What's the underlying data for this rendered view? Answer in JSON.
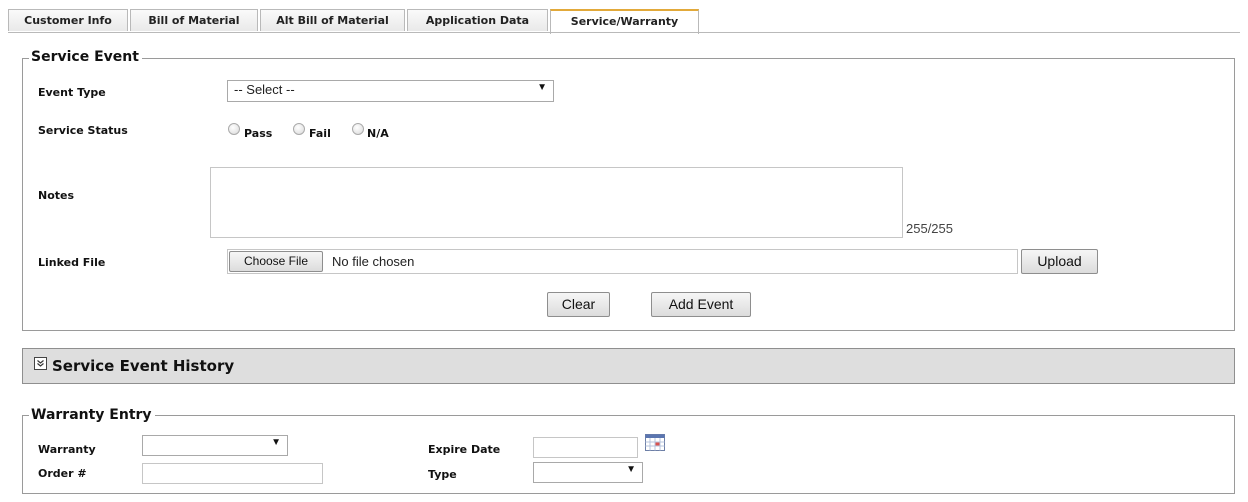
{
  "tabs": [
    {
      "label": "Customer Info"
    },
    {
      "label": "Bill of Material"
    },
    {
      "label": "Alt Bill of Material"
    },
    {
      "label": "Application Data"
    },
    {
      "label": "Service/Warranty"
    }
  ],
  "service_event": {
    "legend": "Service Event",
    "event_type_label": "Event Type",
    "event_type_value": "-- Select --",
    "service_status_label": "Service Status",
    "status_options": [
      "Pass",
      "Fail",
      "N/A"
    ],
    "notes_label": "Notes",
    "notes_counter": "255/255",
    "linked_file_label": "Linked File",
    "choose_file_label": "Choose File",
    "no_file_text": "No file chosen",
    "upload_label": "Upload",
    "clear_label": "Clear",
    "add_event_label": "Add Event"
  },
  "history": {
    "title": "Service Event History",
    "toggle_icon": "double-chevron-down-icon"
  },
  "warranty": {
    "legend": "Warranty Entry",
    "warranty_label": "Warranty",
    "order_label": "Order #",
    "expire_label": "Expire Date",
    "type_label": "Type",
    "calendar_icon": "calendar-icon"
  },
  "colors": {
    "active_tab_accent": "#e2a93a",
    "band_background": "#dedede"
  }
}
